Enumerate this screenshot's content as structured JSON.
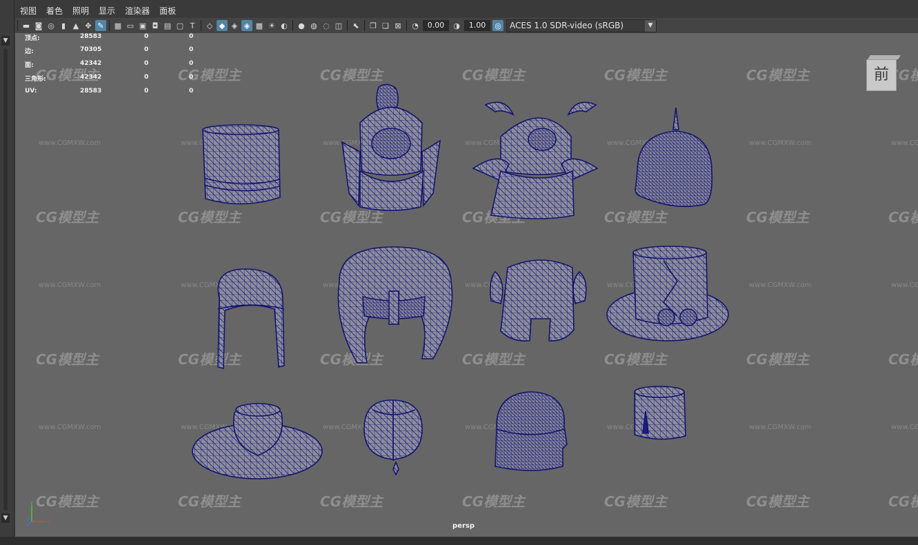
{
  "menu": [
    "视图",
    "着色",
    "照明",
    "显示",
    "渲染器",
    "面板"
  ],
  "toolbar": {
    "icons_group1": [
      "camera-icon",
      "camera-attributes-icon",
      "bookmark-icon",
      "image-plane-icon",
      "film-gate-icon",
      "grease-pencil-icon",
      "pan-zoom-icon"
    ],
    "icons_group2": [
      "grid-icon",
      "safe-frame-icon",
      "resolution-gate-icon",
      "gate-mask-icon",
      "field-chart-icon",
      "safe-action-icon",
      "safe-title-icon"
    ],
    "icons_group3": [
      "wireframe-icon",
      "smooth-shade-icon",
      "default-material-icon",
      "wireframe-on-shaded-icon",
      "textured-icon",
      "use-lights-icon",
      "shadows-icon"
    ],
    "icons_group4": [
      "ambient-occlusion-icon",
      "motion-blur-icon",
      "anti-alias-icon",
      "depth-of-field-icon"
    ],
    "icons_group5": [
      "xray-icon",
      "xray-active-icon",
      "xray-joints-icon",
      "isolate-select-icon"
    ],
    "exposure_value": "0.00",
    "gamma_value": "1.00",
    "color_space": "ACES 1.0 SDR-video (sRGB)"
  },
  "hud": {
    "rows": [
      {
        "label": "顶点:",
        "v1": "28583",
        "v2": "0",
        "v3": "0"
      },
      {
        "label": "边:",
        "v1": "70305",
        "v2": "0",
        "v3": "0"
      },
      {
        "label": "面:",
        "v1": "42342",
        "v2": "0",
        "v3": "0"
      },
      {
        "label": "三角形:",
        "v1": "42342",
        "v2": "0",
        "v3": "0"
      },
      {
        "label": "UV:",
        "v1": "28583",
        "v2": "0",
        "v3": "0"
      }
    ]
  },
  "viewcube_label": "前",
  "camera_label": "persp",
  "watermark": {
    "text": "CG模型主",
    "url": "www.CGMXW.com"
  },
  "colors": {
    "viewport_bg": "#666666",
    "wireframe": "#1a1a7a",
    "mesh_fill": "#8c8c9a",
    "accent": "#5285a6"
  }
}
